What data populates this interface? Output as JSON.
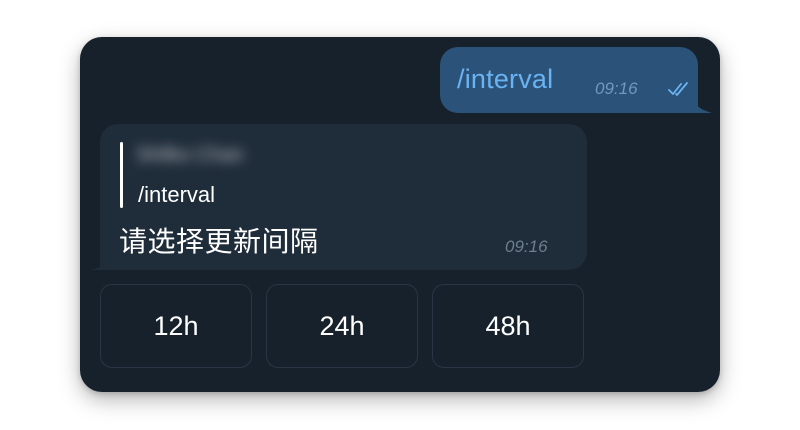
{
  "outgoing": {
    "text": "/interval",
    "time": "09:16",
    "status_icon": "double-check-icon",
    "bubble_color": "#2b5278",
    "text_color": "#6ab3f3"
  },
  "incoming": {
    "reply_to_name": "Shilko Chan",
    "reply_to_text": "/interval",
    "text": "请选择更新间隔",
    "time": "09:16",
    "bubble_color": "#1f2c3a"
  },
  "keyboard": {
    "buttons": [
      {
        "label": "12h"
      },
      {
        "label": "24h"
      },
      {
        "label": "48h"
      }
    ]
  },
  "theme": {
    "background": "#17212b"
  }
}
